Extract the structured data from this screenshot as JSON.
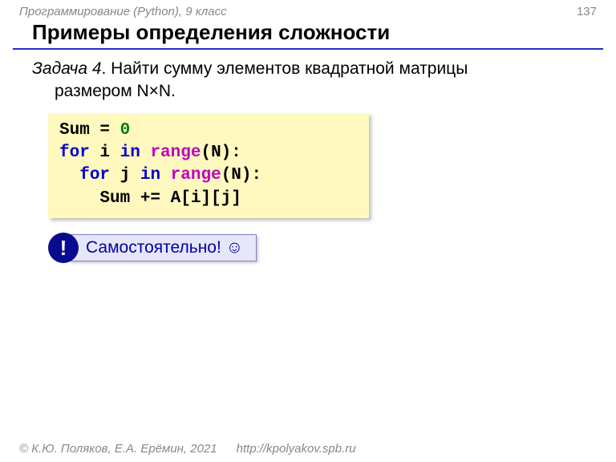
{
  "header": {
    "course": "Программирование (Python), 9 класс",
    "page": "137"
  },
  "title": "Примеры определения сложности",
  "task": {
    "label": "Задача 4",
    "text1": ". Найти сумму элементов квадратной матрицы",
    "text2": "размером N×N."
  },
  "code": {
    "l1a": "Sum",
    "l1b": " = ",
    "l1num": "0",
    "l2a": "for",
    "l2b": " i ",
    "l2c": "in",
    "l2d": " ",
    "l2e": "range",
    "l2f": "(N):",
    "l3a": "  ",
    "l3b": "for",
    "l3c": " j ",
    "l3d": "in",
    "l3e": " ",
    "l3f": "range",
    "l3g": "(N):",
    "l4": "    Sum += A[i][j]"
  },
  "note": {
    "badge": "!",
    "text": "Самостоятельно! ☺"
  },
  "footer": {
    "copyright": "© К.Ю. Поляков, Е.А. Ерёмин, 2021",
    "url": "http://kpolyakov.spb.ru"
  }
}
